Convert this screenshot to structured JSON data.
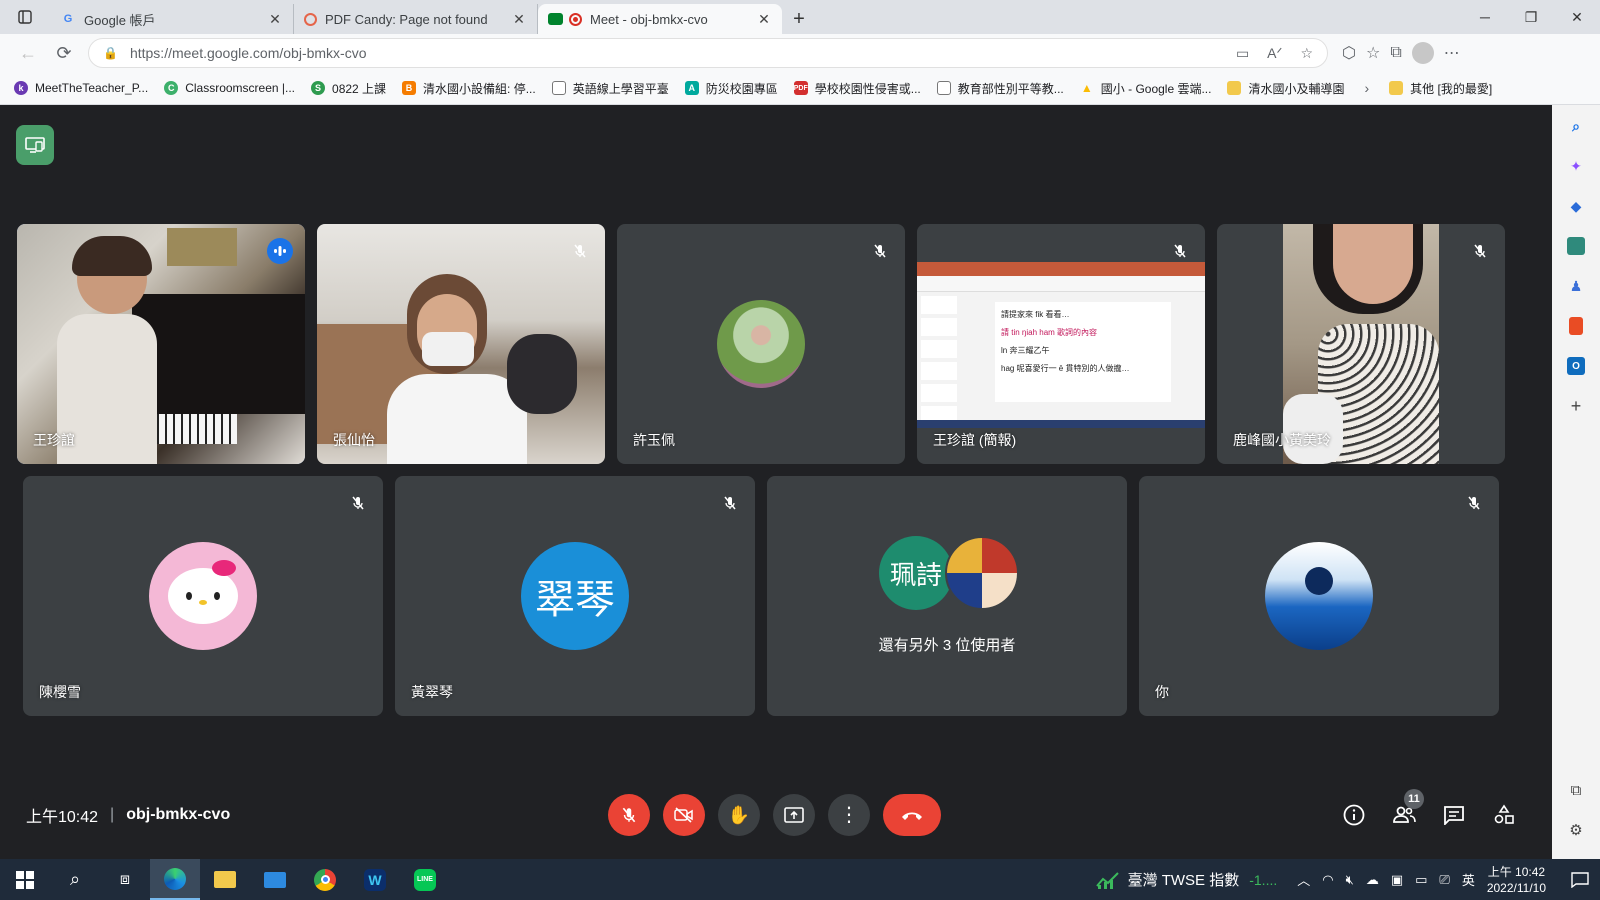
{
  "browser": {
    "tabs": [
      {
        "title": "Google 帳戶",
        "favicon": "google-icon"
      },
      {
        "title": "PDF Candy: Page not found",
        "favicon": "pdfcandy-icon"
      },
      {
        "title": "Meet - obj-bmkx-cvo",
        "favicon": "meet-icon",
        "active": true
      }
    ],
    "url": "https://meet.google.com/obj-bmkx-cvo",
    "bookmarks": [
      {
        "label": "MeetTheTeacher_P...",
        "color": "#6a3ab2",
        "glyph": "k"
      },
      {
        "label": "Classroomscreen |...",
        "color": "#3db06b",
        "glyph": "C"
      },
      {
        "label": "0822 上課",
        "color": "#2e9b4f",
        "glyph": "S"
      },
      {
        "label": "清水國小設備組: 停...",
        "color": "#f57c00",
        "glyph": "B"
      },
      {
        "label": "英語線上學習平臺",
        "color": "#9e9e9e",
        "glyph": ""
      },
      {
        "label": "防災校園專區",
        "color": "#00a99d",
        "glyph": "A"
      },
      {
        "label": "學校校園性侵害或...",
        "color": "#d32f2f",
        "glyph": "P"
      },
      {
        "label": "教育部性別平等教...",
        "color": "#9e9e9e",
        "glyph": ""
      },
      {
        "label": "國小 - Google 雲端...",
        "color": "#fbbc04",
        "glyph": "▲"
      },
      {
        "label": "清水國小及輔導園",
        "color": "#f2c94c",
        "glyph": ""
      }
    ],
    "bookmarks_other": "其他 [我的最愛]"
  },
  "meet": {
    "participants_row1": [
      {
        "name": "王珍誼",
        "speaking": true,
        "mic": "active"
      },
      {
        "name": "張仙怡",
        "mic": "muted"
      },
      {
        "name": "許玉佩",
        "mic": "muted"
      },
      {
        "name": "王珍誼 (簡報)",
        "mic": "muted"
      },
      {
        "name": "鹿峰國小黃美玲",
        "mic": "muted"
      }
    ],
    "participants_row2": [
      {
        "name": "陳櫻雪",
        "mic": "muted"
      },
      {
        "name": "黃翠琴",
        "initials": "翠琴",
        "avatar_color": "#1a8fd8",
        "mic": "muted"
      },
      {
        "name": "",
        "others_label": "還有另外 3 位使用者",
        "initials": "珮詩",
        "avatar_color": "#1e8c6e"
      },
      {
        "name": "你",
        "mic": "muted"
      }
    ],
    "presentation_text": {
      "line1": "請提家來 fik 看看…",
      "line2": "請 tin ŋiah ham 歌詞的內容",
      "line3": "ln 奔三耀乙午",
      "line4": "hag 呢喜愛行一 ē 貫特別的人做攏…"
    },
    "time": "上午10:42",
    "meeting_code": "obj-bmkx-cvo",
    "participant_count": "11"
  },
  "taskbar": {
    "stock_label": "臺灣 TWSE 指數",
    "stock_delta": "-1....",
    "ime": "英",
    "clock_time": "上午 10:42",
    "clock_date": "2022/11/10"
  }
}
